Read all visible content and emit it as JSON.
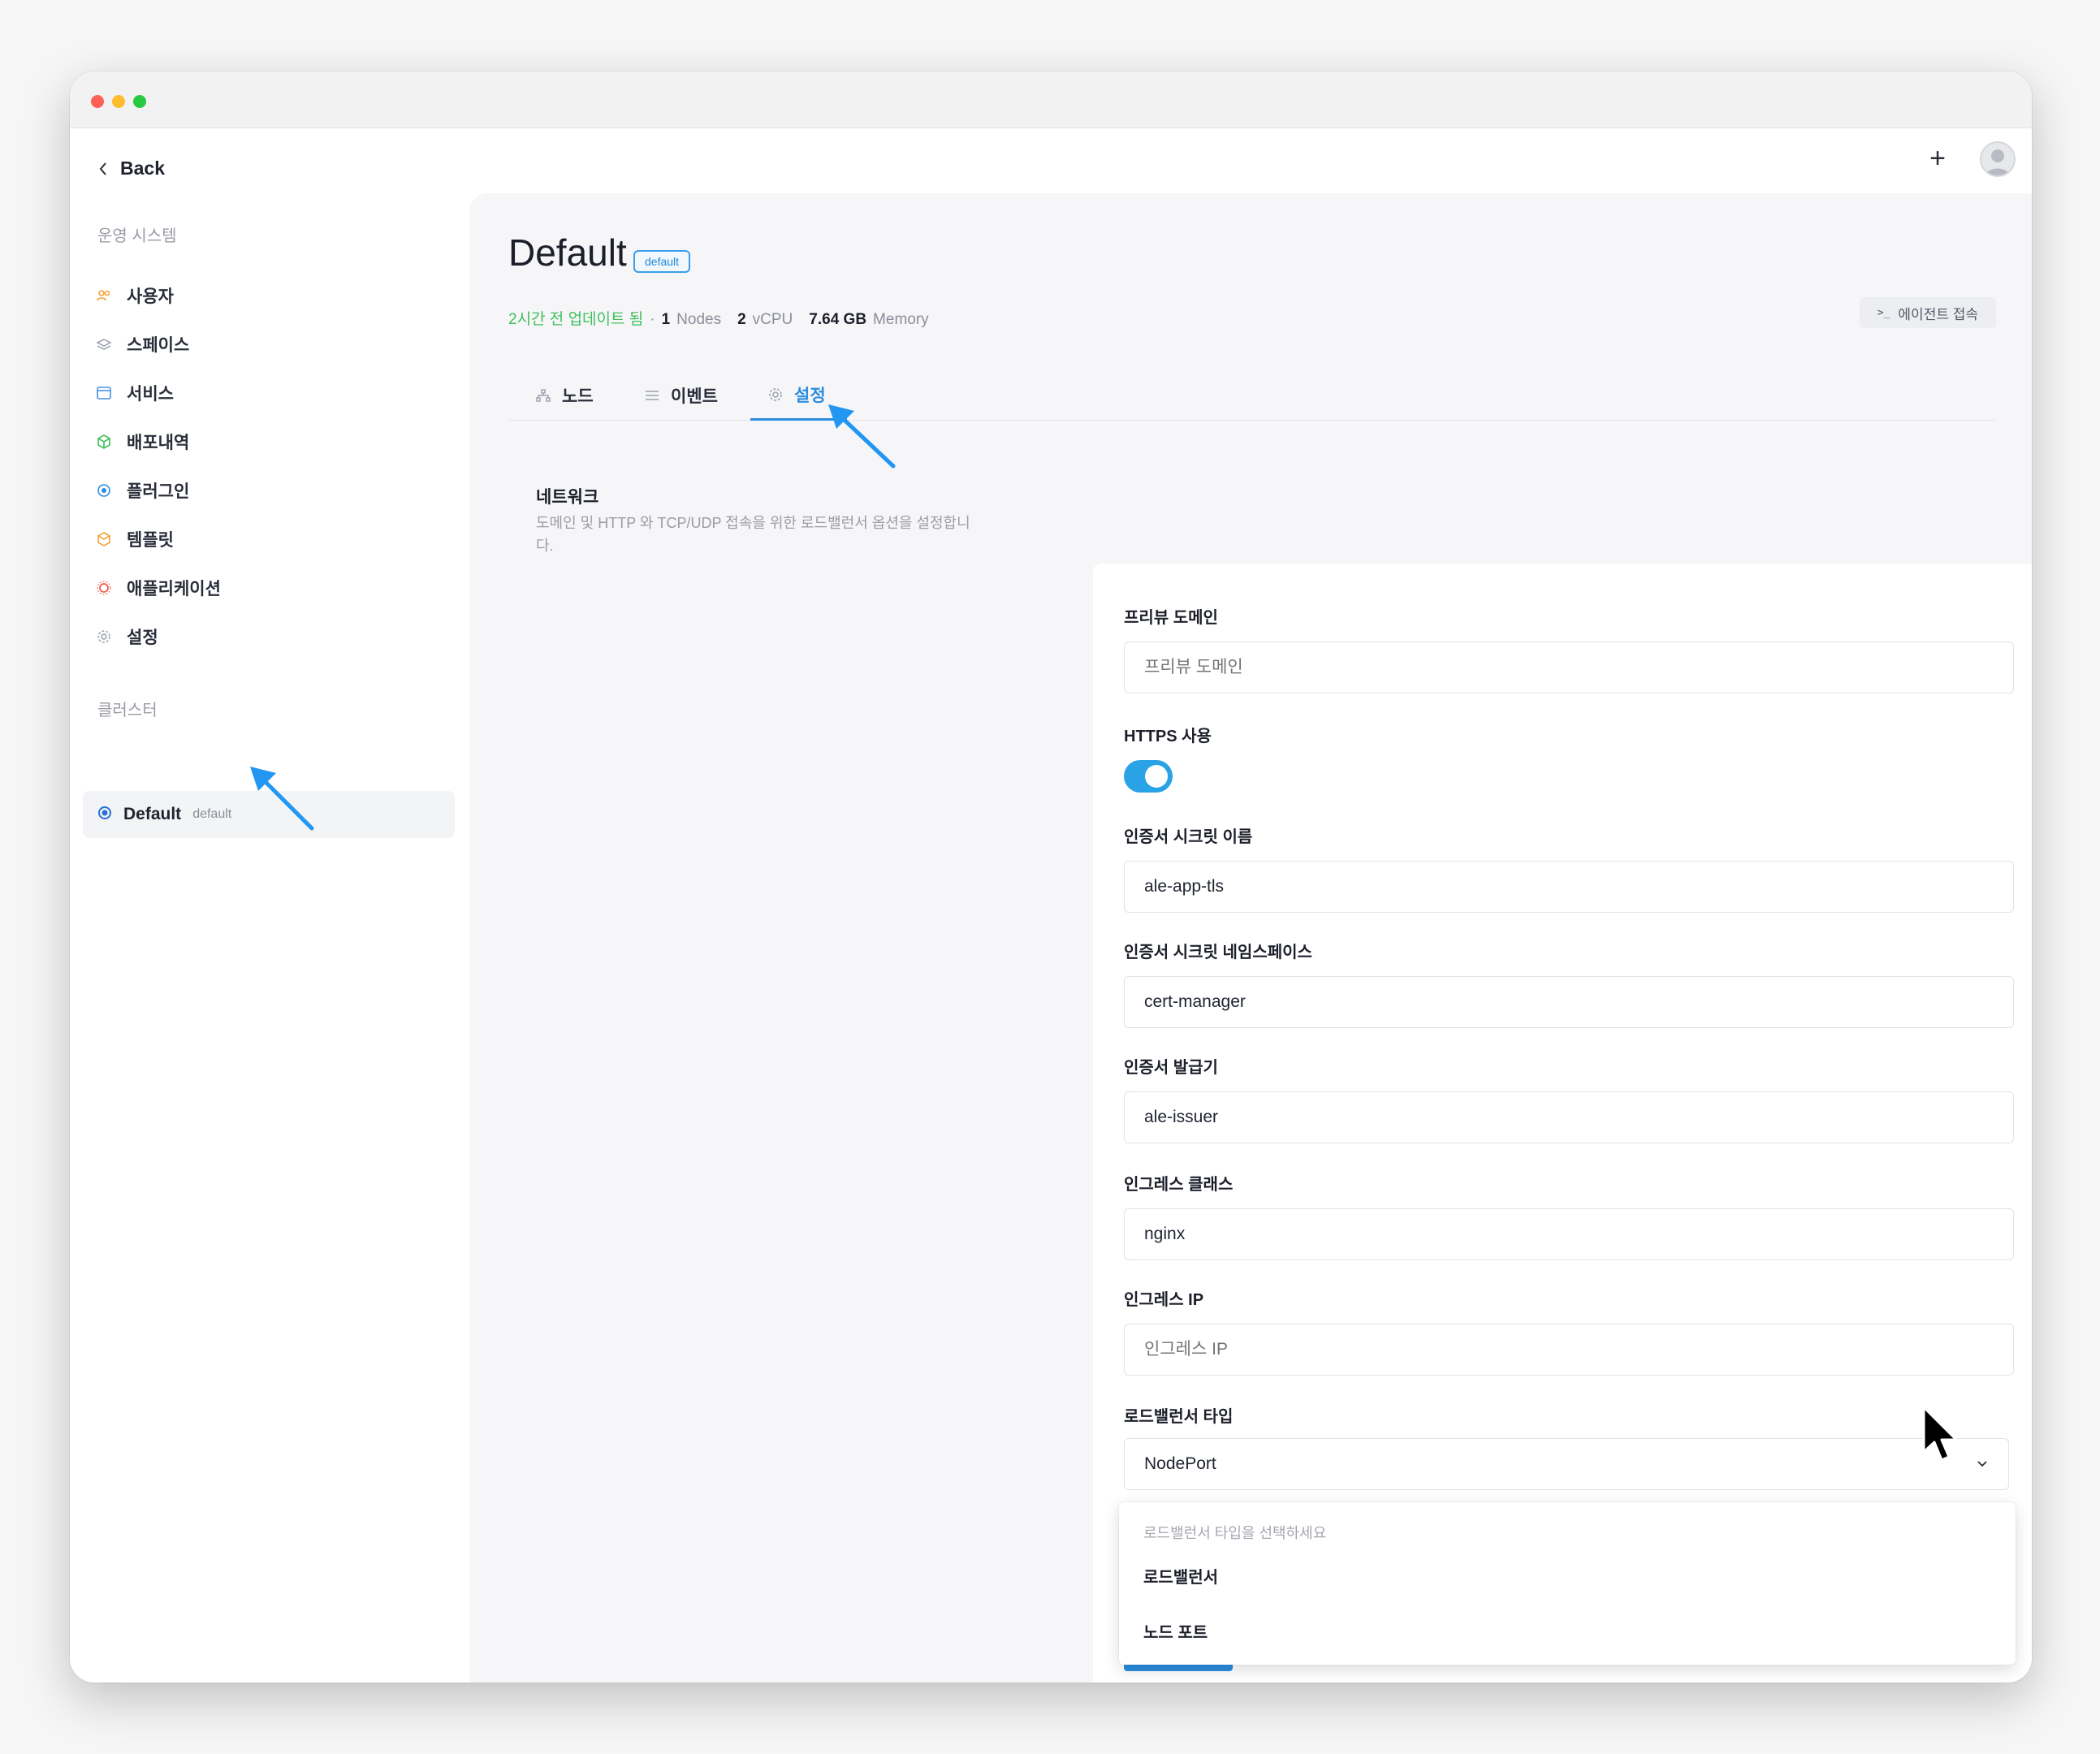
{
  "window": {
    "title": ""
  },
  "nav": {
    "back_label": "Back"
  },
  "sidebar": {
    "section_os": "운영 시스템",
    "items": [
      {
        "label": "사용자",
        "icon": "users-icon"
      },
      {
        "label": "스페이스",
        "icon": "layers-icon"
      },
      {
        "label": "서비스",
        "icon": "window-icon"
      },
      {
        "label": "배포내역",
        "icon": "box-icon"
      },
      {
        "label": "플러그인",
        "icon": "plugin-icon"
      },
      {
        "label": "템플릿",
        "icon": "template-icon"
      },
      {
        "label": "애플리케이션",
        "icon": "app-icon"
      },
      {
        "label": "설정",
        "icon": "settings-icon"
      }
    ],
    "section_cluster": "클러스터",
    "cluster": {
      "name": "Default",
      "tag": "default"
    }
  },
  "header": {
    "plus": "+"
  },
  "page": {
    "title": "Default",
    "badge": "default",
    "updated": "2시간 전 업데이트 됨",
    "separator": "·",
    "nodes_value": "1",
    "nodes_label": "Nodes",
    "vcpu_value": "2",
    "vcpu_label": "vCPU",
    "memory_value": "7.64 GB",
    "memory_label": "Memory",
    "agent_button": "에이전트 접속",
    "agent_icon_text": ">_"
  },
  "tabs": [
    {
      "label": "노드",
      "icon": "hierarchy-icon"
    },
    {
      "label": "이벤트",
      "icon": "list-icon"
    },
    {
      "label": "설정",
      "icon": "settings-icon",
      "active": true
    }
  ],
  "network": {
    "title": "네트워크",
    "description": "도메인 및 HTTP 와 TCP/UDP 접속을 위한 로드밸런서 옵션을 설정합니다."
  },
  "form": {
    "preview_domain": {
      "label": "프리뷰 도메인",
      "value": "",
      "placeholder": "프리뷰 도메인"
    },
    "https": {
      "label": "HTTPS 사용",
      "enabled": true
    },
    "cert_secret_name": {
      "label": "인증서 시크릿 이름",
      "value": "ale-app-tls"
    },
    "cert_secret_namespace": {
      "label": "인증서 시크릿 네임스페이스",
      "value": "cert-manager"
    },
    "cert_issuer": {
      "label": "인증서 발급기",
      "value": "ale-issuer"
    },
    "ingress_class": {
      "label": "인그레스 클래스",
      "value": "nginx"
    },
    "ingress_ip": {
      "label": "인그레스 IP",
      "value": "",
      "placeholder": "인그레스 IP"
    },
    "lb_type": {
      "label": "로드밸런서 타입",
      "value": "NodePort",
      "hint": "로드밸런서 타입을 선택하세요",
      "options": [
        "로드밸런서",
        "노드 포트"
      ]
    }
  },
  "colors": {
    "accent": "#2a8de0",
    "success": "#3fbf5a",
    "annotation_arrow": "#2196f3"
  }
}
